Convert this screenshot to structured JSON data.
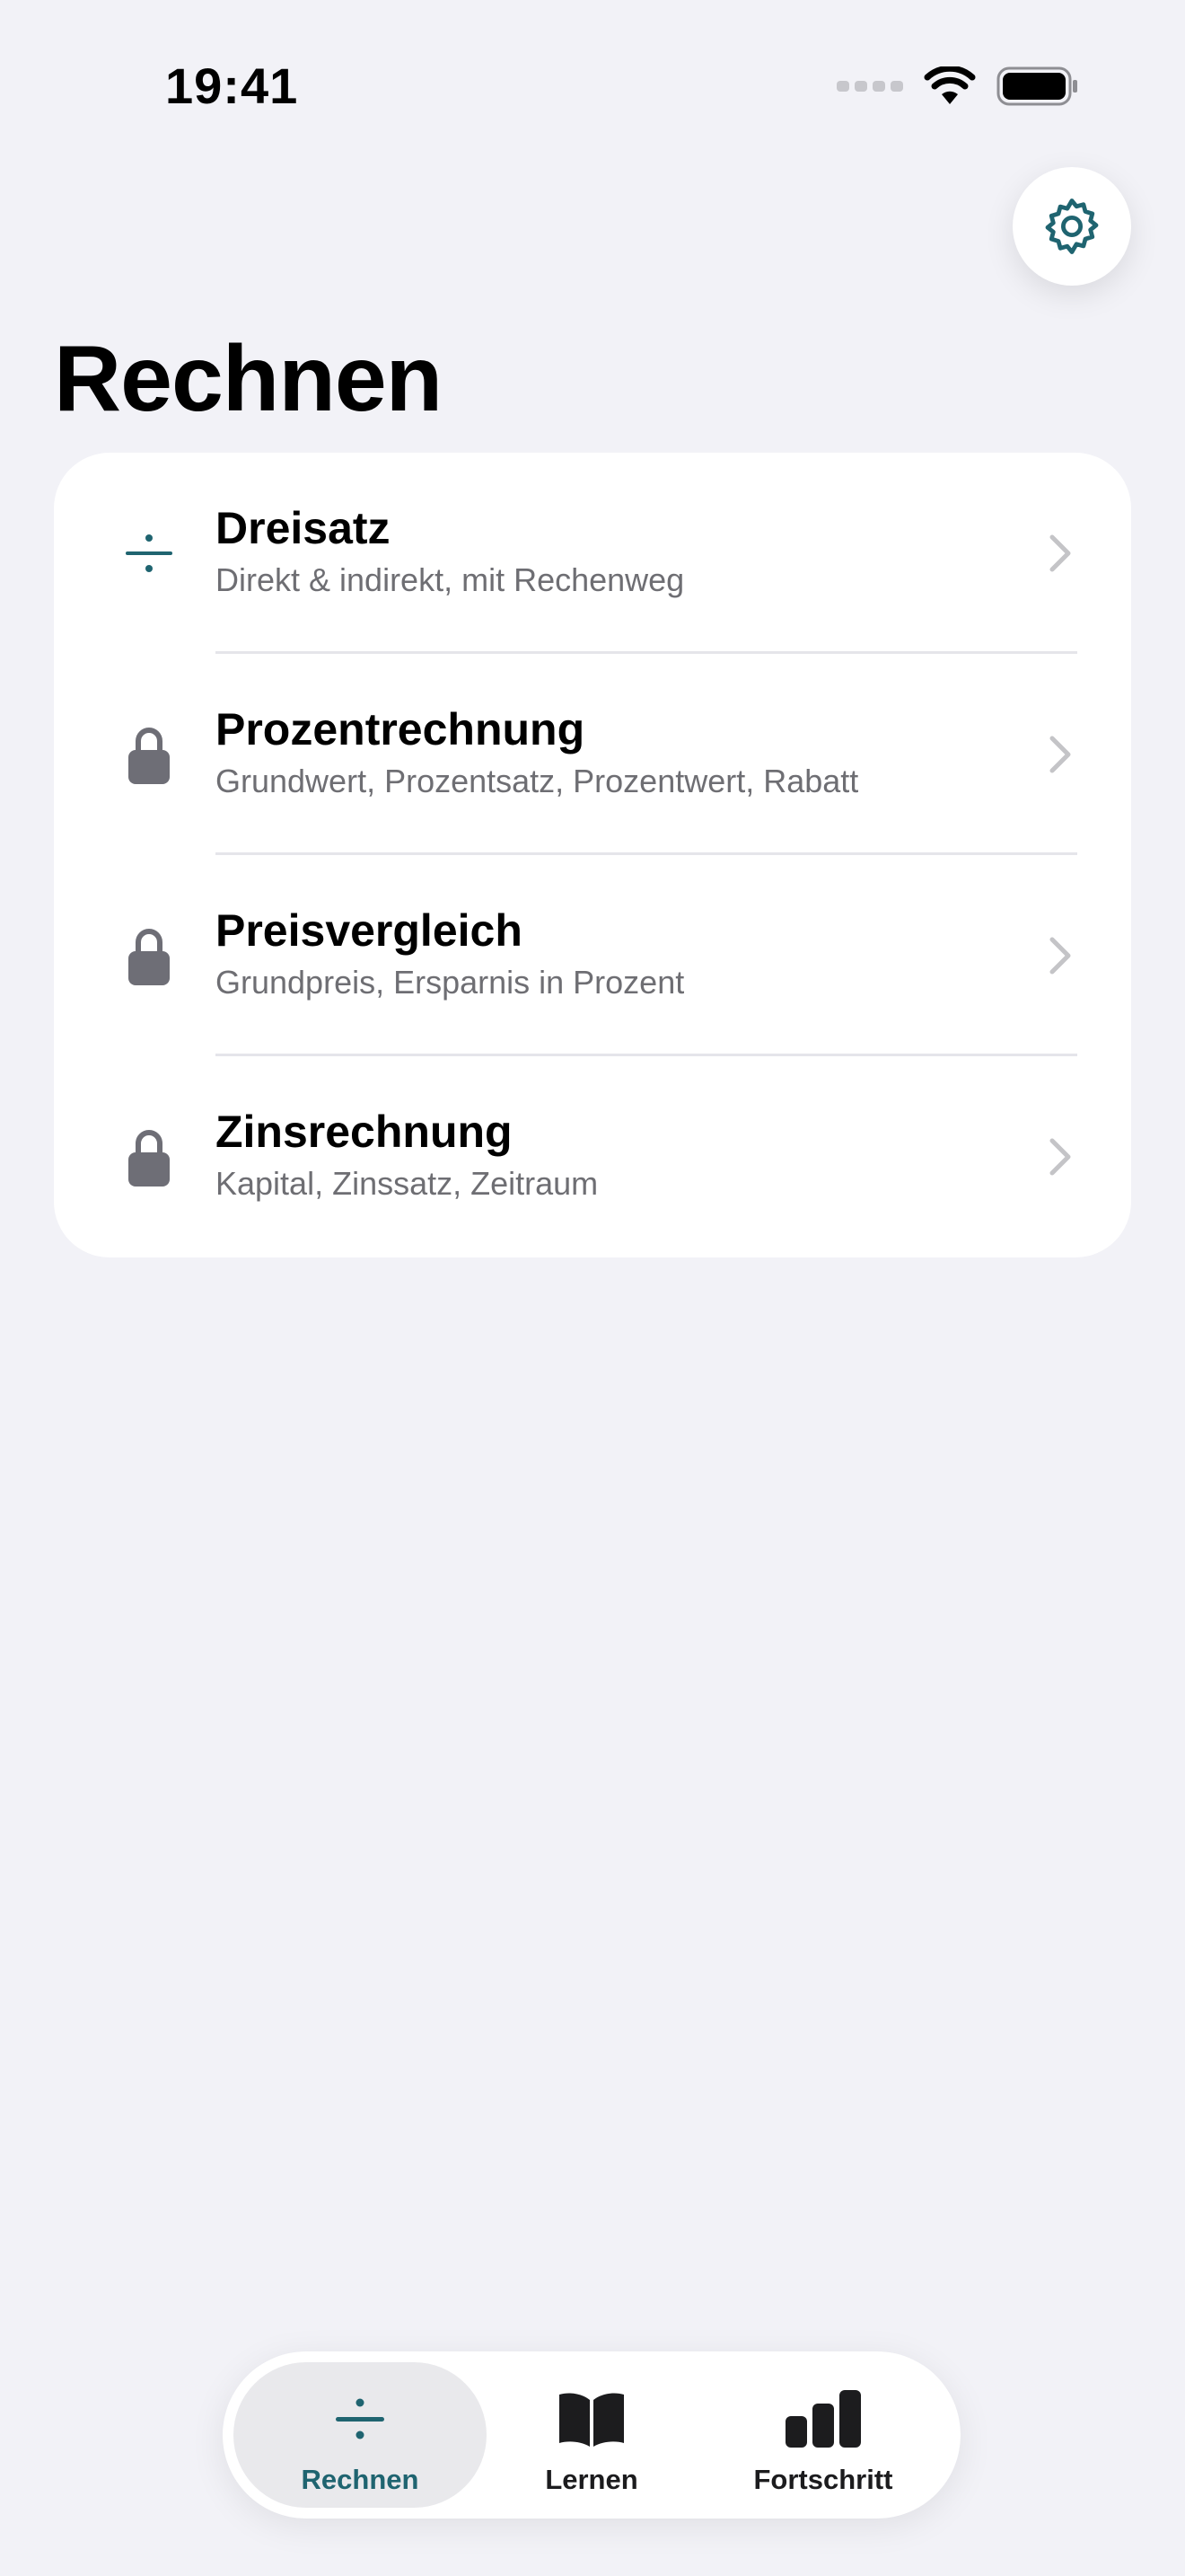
{
  "status_bar": {
    "time": "19:41"
  },
  "header": {
    "title": "Rechnen",
    "settings_icon": "gear-icon"
  },
  "accent_color": "#1f6470",
  "lock_color": "#6e6e76",
  "topics": [
    {
      "title": "Dreisatz",
      "subtitle": "Direkt & indirekt, mit Rechenweg",
      "icon": "divide-icon",
      "locked": false
    },
    {
      "title": "Prozentrechnung",
      "subtitle": "Grundwert, Prozentsatz, Prozentwert, Rabatt",
      "icon": "lock-icon",
      "locked": true
    },
    {
      "title": "Preisvergleich",
      "subtitle": "Grundpreis, Ersparnis in Prozent",
      "icon": "lock-icon",
      "locked": true
    },
    {
      "title": "Zinsrechnung",
      "subtitle": "Kapital, Zinssatz, Zeitraum",
      "icon": "lock-icon",
      "locked": true
    }
  ],
  "tabbar": {
    "tabs": [
      {
        "label": "Rechnen",
        "icon": "divide-icon",
        "active": true
      },
      {
        "label": "Lernen",
        "icon": "book-icon",
        "active": false
      },
      {
        "label": "Fortschritt",
        "icon": "bar-chart-icon",
        "active": false
      }
    ]
  }
}
